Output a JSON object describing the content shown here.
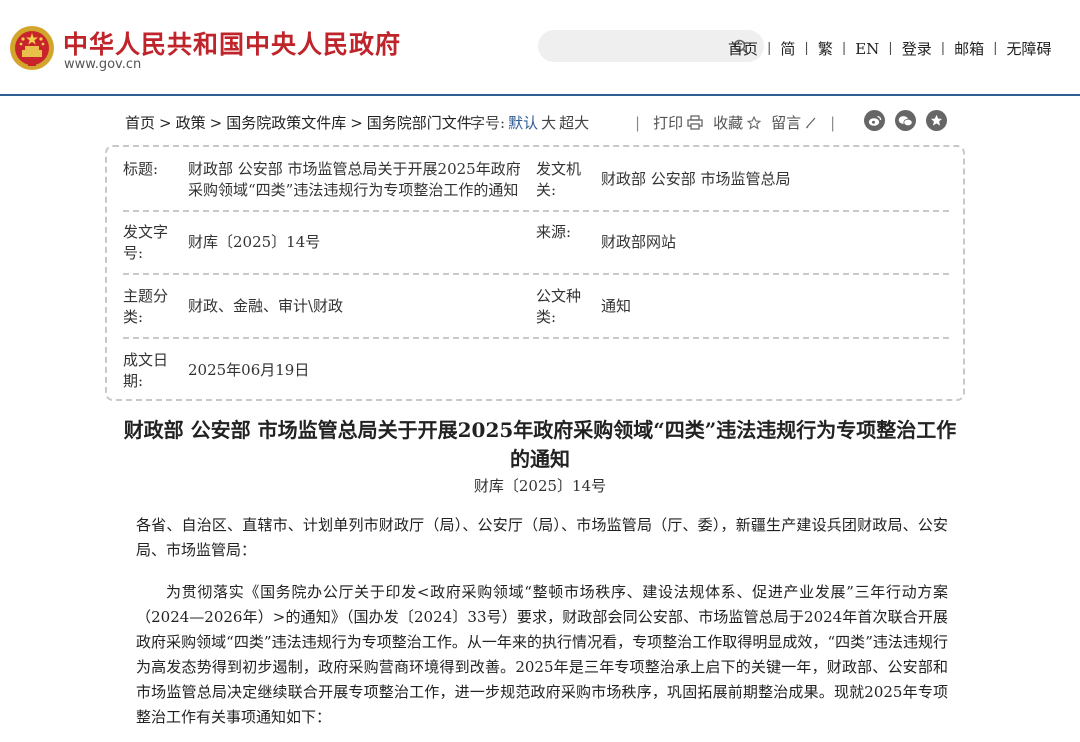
{
  "header": {
    "site_title": "中华人民共和国中央人民政府",
    "site_url": "www.gov.cn",
    "nav": [
      "首页",
      "简",
      "繁",
      "EN",
      "登录",
      "邮箱",
      "无障碍"
    ],
    "nav_separator": "|"
  },
  "toolbar": {
    "breadcrumb": [
      "首页",
      "政策",
      "国务院政策文件库",
      "国务院部门文件"
    ],
    "breadcrumb_separator": ">",
    "fontsize_label": "字号:",
    "fontsize_options": [
      "默认",
      "大",
      "超大"
    ],
    "separator": "|",
    "print_label": "打印",
    "favorite_label": "收藏",
    "comment_label": "留言"
  },
  "info": {
    "title_label": "标题:",
    "title_value": "财政部 公安部 市场监管总局关于开展2025年政府采购领域“四类”违法违规行为专项整治工作的通知",
    "issuer_label": "发文机关:",
    "issuer_value": "财政部 公安部 市场监管总局",
    "docno_label": "发文字号:",
    "docno_value": "财库〔2025〕14号",
    "source_label": "来源:",
    "source_value": "财政部网站",
    "topic_label": "主题分类:",
    "topic_value": "财政、金融、审计\\财政",
    "type_label": "公文种类:",
    "type_value": "通知",
    "date_label": "成文日期:",
    "date_value": "2025年06月19日"
  },
  "article": {
    "title": "财政部 公安部 市场监管总局关于开展2025年政府采购领域“四类”违法违规行为专项整治工作的通知",
    "doc_number": "财库〔2025〕14号",
    "salutation": "各省、自治区、直辖市、计划单列市财政厅（局）、公安厅（局）、市场监管局（厅、委），新疆生产建设兵团财政局、公安局、市场监管局：",
    "paragraph1": "为贯彻落实《国务院办公厅关于印发<政府采购领域“整顿市场秩序、建设法规体系、促进产业发展”三年行动方案（2024—2026年）>的通知》（国办发〔2024〕33号）要求，财政部会同公安部、市场监管总局于2024年首次联合开展政府采购领域“四类”违法违规行为专项整治工作。从一年来的执行情况看，专项整治工作取得明显成效，“四类”违法违规行为高发态势得到初步遏制，政府采购营商环境得到改善。2025年是三年专项整治承上启下的关键一年，财政部、公安部和市场监管总局决定继续联合开展专项整治工作，进一步规范政府采购市场秩序，巩固拓展前期整治成果。现就2025年专项整治工作有关事项通知如下："
  },
  "colors": {
    "brand_red": "#c0242b",
    "header_line": "#2f5d94",
    "active_fontsize": "#2f5d94"
  },
  "icons": [
    "national-emblem-icon",
    "search-icon",
    "print-icon",
    "star-icon",
    "pencil-icon",
    "weibo-icon",
    "wechat-icon",
    "favorite-share-icon"
  ]
}
